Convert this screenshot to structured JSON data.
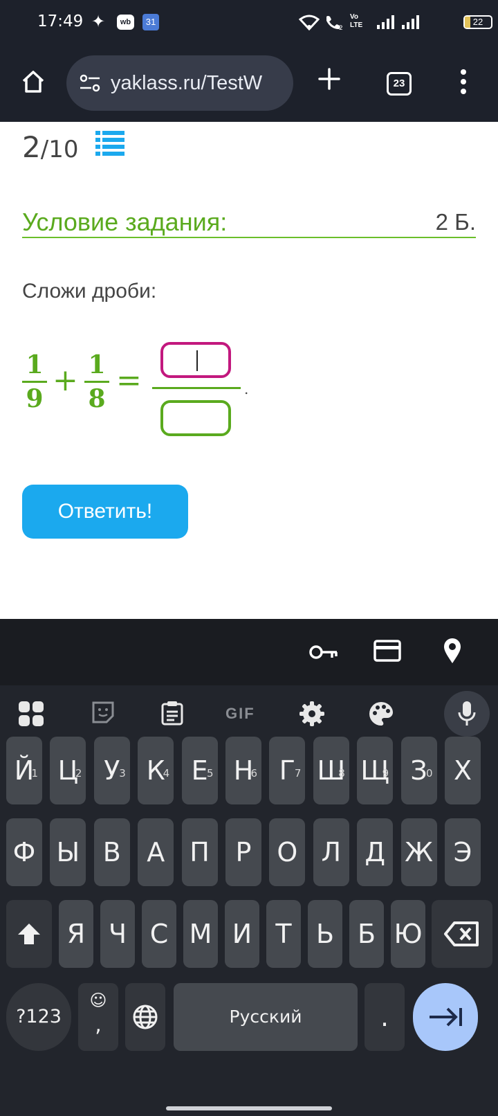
{
  "status_bar": {
    "time": "17:49",
    "wb_badge": "wb",
    "calendar_badge": "31",
    "volte": "Vo LTE",
    "battery": "22"
  },
  "browser": {
    "url": "yaklass.ru/TestW",
    "tab_count": "23"
  },
  "page": {
    "progress_current": "2",
    "progress_total": "/10",
    "task_title": "Условие задания:",
    "task_points": "2 Б.",
    "instruction": "Сложи дроби:",
    "fraction1": {
      "num": "1",
      "den": "9"
    },
    "fraction2": {
      "num": "1",
      "den": "8"
    },
    "plus": "+",
    "equals": "=",
    "period": ".",
    "submit_label": "Ответить!"
  },
  "keyboard": {
    "icons_suggest": [
      "key-icon",
      "card-icon",
      "location-icon"
    ],
    "icons_tools": [
      "apps-icon",
      "sticker-icon",
      "clipboard-icon",
      "gif-icon",
      "settings-icon",
      "palette-icon",
      "mic-icon"
    ],
    "gif_label": "GIF",
    "row1": [
      {
        "k": "Й",
        "h": "1"
      },
      {
        "k": "Ц",
        "h": "2"
      },
      {
        "k": "У",
        "h": "3"
      },
      {
        "k": "К",
        "h": "4"
      },
      {
        "k": "Е",
        "h": "5"
      },
      {
        "k": "Н",
        "h": "6"
      },
      {
        "k": "Г",
        "h": "7"
      },
      {
        "k": "Ш",
        "h": "8"
      },
      {
        "k": "Щ",
        "h": "9"
      },
      {
        "k": "З",
        "h": "0"
      },
      {
        "k": "Х",
        "h": ""
      }
    ],
    "row2": [
      "Ф",
      "Ы",
      "В",
      "А",
      "П",
      "Р",
      "О",
      "Л",
      "Д",
      "Ж",
      "Э"
    ],
    "row3": [
      "Я",
      "Ч",
      "С",
      "М",
      "И",
      "Т",
      "Ь",
      "Б",
      "Ю"
    ],
    "symbols_label": "?123",
    "emoji_label": "☺",
    "comma": ",",
    "space_label": "Русский",
    "period_key": "."
  }
}
